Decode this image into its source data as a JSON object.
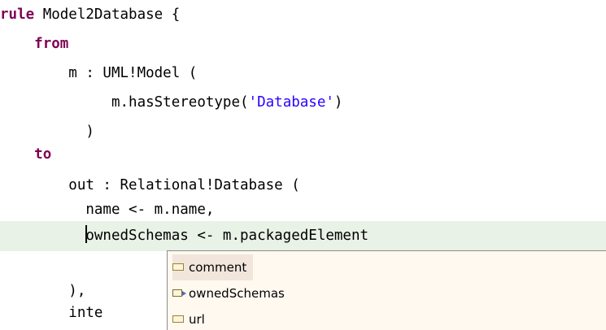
{
  "editor": {
    "line1": {
      "kw": "rule",
      "rest": " Model2Database {"
    },
    "line2": {
      "indent": "    ",
      "kw": "from"
    },
    "line3": {
      "text": "        m : UML!Model ("
    },
    "line4": {
      "pre": "             m.hasStereotype(",
      "str": "'Database'",
      "post": ")"
    },
    "line5": {
      "text": "          )"
    },
    "line6": {
      "indent": "    ",
      "kw": "to"
    },
    "line7": {
      "text": "        out : Relational!Database ("
    },
    "line8": {
      "text": "          name <- m.name,"
    },
    "line9": {
      "pre": "          ",
      "text": "ownedSchemas <- m.packagedElement"
    },
    "line10": {
      "text": "        ),"
    },
    "line11": {
      "text": "        inte"
    }
  },
  "autocomplete": {
    "items": [
      {
        "label": "comment",
        "icon": "property-icon"
      },
      {
        "label": "ownedSchemas",
        "icon": "reference-icon"
      },
      {
        "label": "url",
        "icon": "property-icon"
      }
    ],
    "selected_index": 0
  },
  "colors": {
    "keyword": "#7f0055",
    "string": "#2a00ff",
    "current_line": "#e8f2e6",
    "popup_bg": "#fff9f0"
  }
}
